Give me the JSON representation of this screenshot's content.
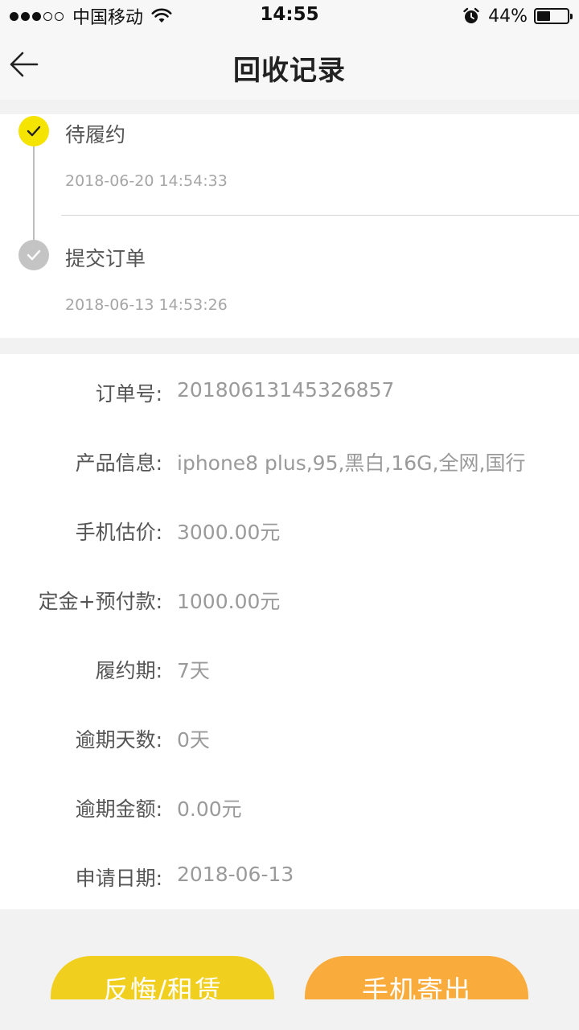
{
  "status_bar": {
    "carrier": "中国移动",
    "time": "14:55",
    "battery_percent": "44%",
    "battery_level": 0.44,
    "signal_bars_filled": 3,
    "signal_bars_total": 5
  },
  "header": {
    "title": "回收记录",
    "back_icon": "arrow-left-icon"
  },
  "timeline": [
    {
      "title": "待履约",
      "time": "2018-06-20 14:54:33",
      "state": "active"
    },
    {
      "title": "提交订单",
      "time": "2018-06-13 14:53:26",
      "state": "done"
    }
  ],
  "details": [
    {
      "label": "订单号:",
      "value": "20180613145326857"
    },
    {
      "label": "产品信息:",
      "value": "iphone8 plus,95,黑白,16G,全网,国行"
    },
    {
      "label": "手机估价:",
      "value": "3000.00元"
    },
    {
      "label": "定金+预付款:",
      "value": "1000.00元"
    },
    {
      "label": "履约期:",
      "value": "7天"
    },
    {
      "label": "逾期天数:",
      "value": "0天"
    },
    {
      "label": "逾期金额:",
      "value": "0.00元"
    },
    {
      "label": "申请日期:",
      "value": "2018-06-13"
    }
  ],
  "actions": {
    "regret_label": "反悔/租赁",
    "send_label": "手机寄出"
  },
  "colors": {
    "active_step": "#f5e300",
    "done_step": "#c4c4c4",
    "regret_button": "#f0cf1f",
    "send_button": "#f9ab3b"
  }
}
